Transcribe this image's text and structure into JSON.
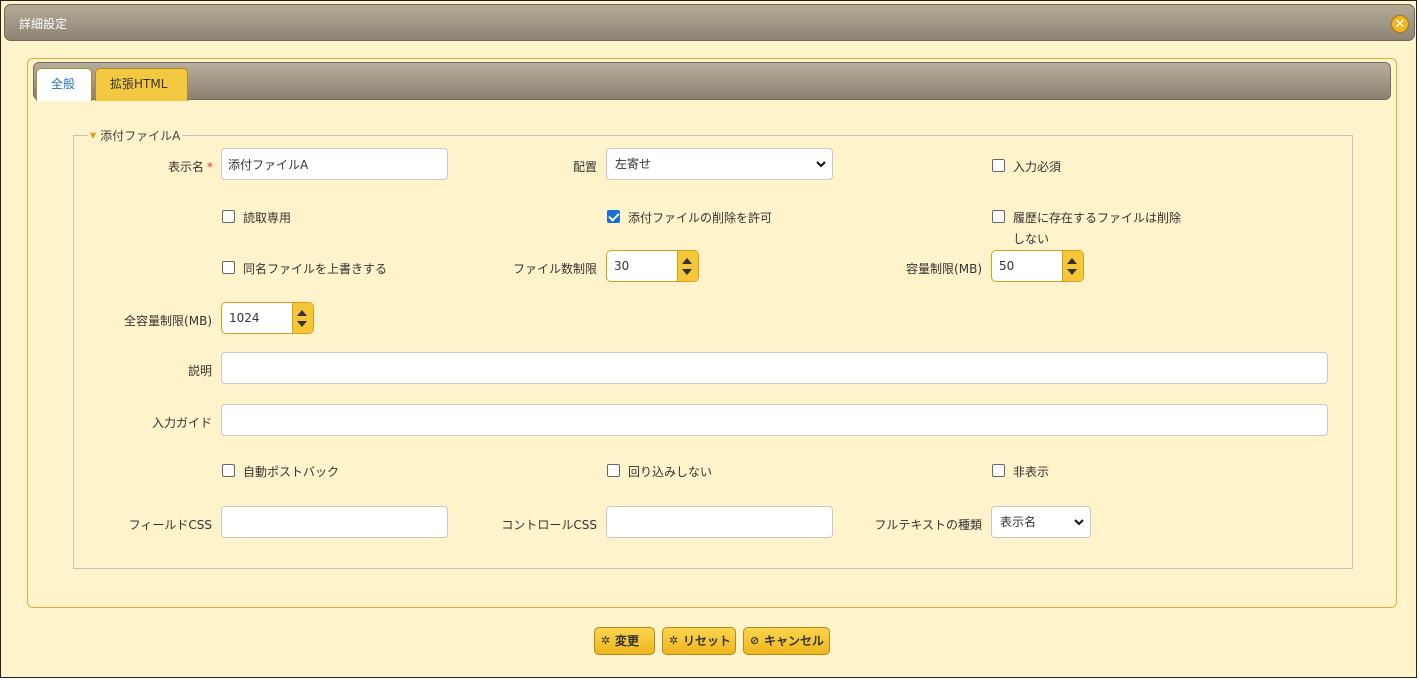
{
  "dialog": {
    "title": "詳細設定",
    "close_glyph": "✕"
  },
  "tabs": [
    {
      "label": "全般",
      "active": true
    },
    {
      "label": "拡張HTML",
      "active": false
    }
  ],
  "section": {
    "legend": "添付ファイルA"
  },
  "fields": {
    "display_name": {
      "label": "表示名",
      "required_mark": "*",
      "value": "添付ファイルA"
    },
    "placement": {
      "label": "配置",
      "selected": "左寄せ"
    },
    "input_required": {
      "label": "入力必須",
      "checked": false
    },
    "read_only": {
      "label": "読取専用",
      "checked": false
    },
    "allow_delete": {
      "label": "添付ファイルの削除を許可",
      "checked": true
    },
    "history_no_delete": {
      "label_line1": "履歴に存在するファイルは削除",
      "label_line2": "しない",
      "checked": false
    },
    "overwrite_same_name": {
      "label": "同名ファイルを上書きする",
      "checked": false
    },
    "file_count_limit": {
      "label": "ファイル数制限",
      "value": "30"
    },
    "size_limit": {
      "label": "容量制限(MB)",
      "value": "50"
    },
    "total_size_limit": {
      "label": "全容量制限(MB)",
      "value": "1024"
    },
    "description": {
      "label": "説明",
      "value": ""
    },
    "input_guide": {
      "label": "入力ガイド",
      "value": ""
    },
    "auto_postback": {
      "label": "自動ポストバック",
      "checked": false
    },
    "no_wrap": {
      "label": "回り込みしない",
      "checked": false
    },
    "hidden": {
      "label": "非表示",
      "checked": false
    },
    "field_css": {
      "label": "フィールドCSS",
      "value": ""
    },
    "control_css": {
      "label": "コントロールCSS",
      "value": ""
    },
    "fulltext_type": {
      "label": "フルテキストの種類",
      "selected": "表示名"
    }
  },
  "buttons": {
    "change": {
      "label": "変更",
      "icon": "✲"
    },
    "reset": {
      "label": "リセット",
      "icon": "✲"
    },
    "cancel": {
      "label": "キャンセル",
      "icon": "⊘"
    }
  },
  "colors": {
    "accent": "#f5c637",
    "background": "#fef3ca",
    "titlebar": "#9e9583",
    "checkbox_checked": "#1b6fd0",
    "required": "#d63232"
  }
}
